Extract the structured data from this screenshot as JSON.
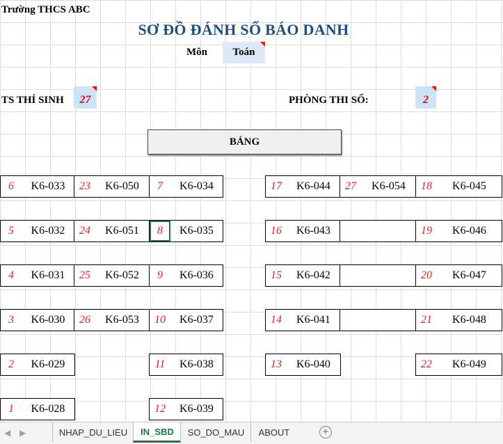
{
  "header": {
    "school": "Trường  THCS ABC",
    "title": "SƠ ĐỒ ĐÁNH SỐ BÁO DANH",
    "subject_label": "Môn",
    "subject_value": "Toán",
    "total_label": "TS THÍ SINH",
    "total_value": "27",
    "room_label": "PHÒNG THI SỐ:",
    "room_value": "2",
    "board_label": "BẢNG"
  },
  "seats": {
    "col1": [
      {
        "num": "6",
        "code": "K6-033"
      },
      {
        "num": "5",
        "code": "K6-032"
      },
      {
        "num": "4",
        "code": "K6-031"
      },
      {
        "num": "3",
        "code": "K6-030"
      },
      {
        "num": "2",
        "code": "K6-029"
      },
      {
        "num": "1",
        "code": "K6-028"
      }
    ],
    "col2": [
      {
        "num": "23",
        "code": "K6-050"
      },
      {
        "num": "24",
        "code": "K6-051"
      },
      {
        "num": "25",
        "code": "K6-052"
      },
      {
        "num": "26",
        "code": "K6-053"
      }
    ],
    "col3": [
      {
        "num": "7",
        "code": "K6-034"
      },
      {
        "num": "8",
        "code": "K6-035"
      },
      {
        "num": "9",
        "code": "K6-036"
      },
      {
        "num": "10",
        "code": "K6-037"
      },
      {
        "num": "11",
        "code": "K6-038"
      },
      {
        "num": "12",
        "code": "K6-039"
      }
    ],
    "col4": [
      {
        "num": "17",
        "code": "K6-044"
      },
      {
        "num": "16",
        "code": "K6-043"
      },
      {
        "num": "15",
        "code": "K6-042"
      },
      {
        "num": "14",
        "code": "K6-041"
      },
      {
        "num": "13",
        "code": "K6-040"
      }
    ],
    "col5": [
      {
        "num": "27",
        "code": "K6-054"
      },
      {
        "num": "",
        "code": ""
      },
      {
        "num": "",
        "code": ""
      },
      {
        "num": "",
        "code": ""
      }
    ],
    "col6": [
      {
        "num": "18",
        "code": "K6-045"
      },
      {
        "num": "19",
        "code": "K6-046"
      },
      {
        "num": "20",
        "code": "K6-047"
      },
      {
        "num": "21",
        "code": "K6-048"
      },
      {
        "num": "22",
        "code": "K6-049"
      }
    ]
  },
  "tabs": [
    {
      "label": "NHAP_DU_LIEU",
      "active": false
    },
    {
      "label": "IN_SBD",
      "active": true
    },
    {
      "label": "SO_DO_MAU",
      "active": false
    },
    {
      "label": "ABOUT",
      "active": false
    }
  ],
  "icons": {
    "add_sheet": "plus-circle-icon",
    "nav_prev": "caret-left-icon",
    "nav_next": "caret-right-icon"
  },
  "colors": {
    "title": "#1f4e79",
    "seat_number": "#e02020",
    "active_tab": "#217346",
    "highlight_cell": "#cfe3f7"
  }
}
